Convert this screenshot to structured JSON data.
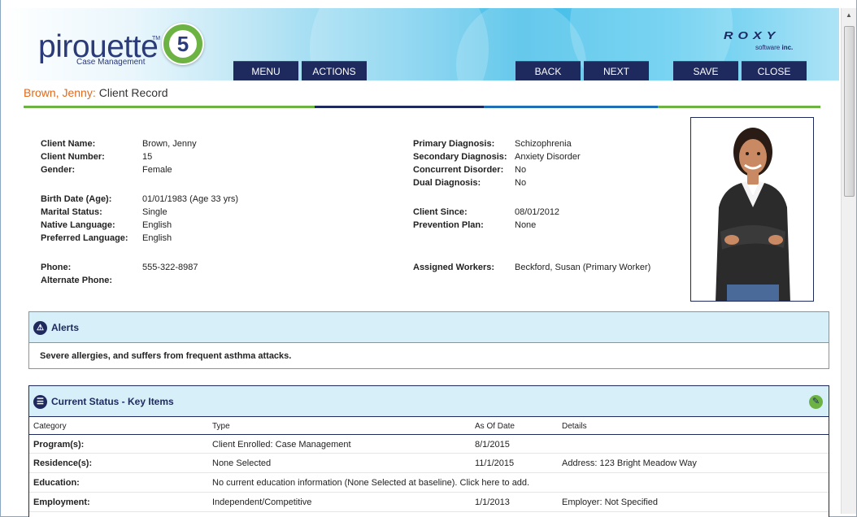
{
  "header": {
    "logo_text": "pirouette",
    "logo_tm": "TM",
    "logo_subtitle": "Case Management",
    "logo_version": "5",
    "vendor_logo": "ROXY",
    "vendor_sub_prefix": "software",
    "vendor_sub_suffix": "inc.",
    "buttons": {
      "menu": "MENU",
      "actions": "ACTIONS",
      "back": "BACK",
      "next": "NEXT",
      "save": "SAVE",
      "close": "CLOSE"
    }
  },
  "title": {
    "client": "Brown, Jenny:",
    "record": "Client Record"
  },
  "client": {
    "left": [
      {
        "label": "Client Name:",
        "value": "Brown, Jenny"
      },
      {
        "label": "Client Number:",
        "value": "15"
      },
      {
        "label": "Gender:",
        "value": "Female"
      },
      {
        "label": "Birth Date (Age):",
        "value": "01/01/1983 (Age 33 yrs)"
      },
      {
        "label": "Marital Status:",
        "value": "Single"
      },
      {
        "label": "Native Language:",
        "value": "English"
      },
      {
        "label": "Preferred Language:",
        "value": "English"
      },
      {
        "label": "Phone:",
        "value": "555-322-8987"
      },
      {
        "label": "Alternate Phone:",
        "value": ""
      }
    ],
    "right": [
      {
        "label": "Primary Diagnosis:",
        "value": "Schizophrenia"
      },
      {
        "label": "Secondary Diagnosis:",
        "value": "Anxiety Disorder"
      },
      {
        "label": "Concurrent Disorder:",
        "value": "No"
      },
      {
        "label": "Dual Diagnosis:",
        "value": "No"
      },
      {
        "label": "Client Since:",
        "value": "08/01/2012"
      },
      {
        "label": "Prevention Plan:",
        "value": "None"
      },
      {
        "label": "Assigned Workers:",
        "value": "Beckford, Susan (Primary Worker)"
      }
    ]
  },
  "alerts": {
    "title": "Alerts",
    "icon": "warning-icon",
    "text": "Severe allergies, and suffers from frequent asthma attacks."
  },
  "status": {
    "title": "Current Status - Key Items",
    "icon": "list-icon",
    "action_icon": "wrench-icon",
    "columns": [
      "Category",
      "Type",
      "As Of Date",
      "Details"
    ],
    "rows": [
      {
        "category": "Program(s):",
        "type": "Client Enrolled: Case Management",
        "date": "8/1/2015",
        "details": ""
      },
      {
        "category": "Residence(s):",
        "type": "None Selected",
        "date": "11/1/2015",
        "details": "Address: 123 Bright Meadow Way"
      },
      {
        "category": "Education:",
        "type": "No current education information (None Selected at baseline). Click here to add.",
        "date": "",
        "details": ""
      },
      {
        "category": "Employment:",
        "type": "Independent/Competitive",
        "date": "1/1/2013",
        "details": "Employer: Not Specified"
      }
    ]
  },
  "colors": {
    "navy": "#1e2a5e",
    "accent_orange": "#e06a1d",
    "accent_green": "#6cb344",
    "accent_blue": "#1f6fb5",
    "panel_bg": "#d6eff9"
  }
}
